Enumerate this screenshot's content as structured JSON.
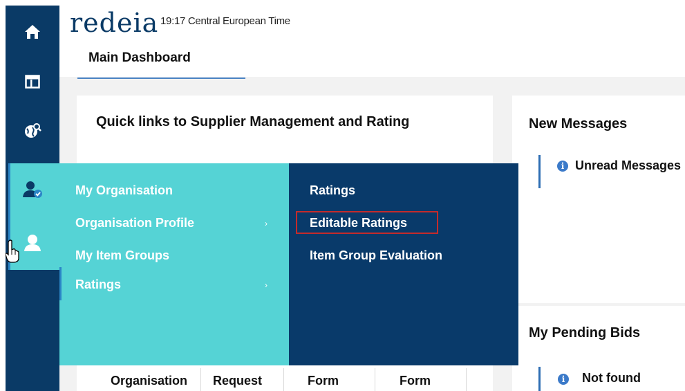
{
  "header": {
    "logo_text": "redeia",
    "time": "19:17 Central European Time",
    "tab": "Main Dashboard"
  },
  "rail": {
    "icons": [
      "home-icon",
      "dashboard-layout-icon",
      "globe-search-icon",
      "user-check-icon",
      "user-icon"
    ]
  },
  "quick_links": {
    "title": "Quick links to Supplier Management and Rating",
    "table_headers": [
      "Organisation",
      "Request",
      "Form",
      "Form"
    ]
  },
  "new_messages": {
    "title": "New Messages",
    "info": "Unread Messages"
  },
  "pending_bids": {
    "title": "My Pending Bids",
    "info": "Not found"
  },
  "menu": {
    "left": [
      {
        "label": "My Organisation",
        "has_submenu": false
      },
      {
        "label": "Organisation Profile",
        "has_submenu": true
      },
      {
        "label": "My Item Groups",
        "has_submenu": false
      },
      {
        "label": "Ratings",
        "has_submenu": true
      }
    ],
    "right": [
      {
        "label": "Ratings"
      },
      {
        "label": "Editable Ratings"
      },
      {
        "label": "Item Group Evaluation"
      }
    ],
    "arrow": "›"
  },
  "colors": {
    "rail": "#0a3a66",
    "menu_primary": "#55d3d5",
    "menu_secondary": "#093a6a",
    "highlight_border": "#c42b2b",
    "accent": "#4a83c4"
  }
}
